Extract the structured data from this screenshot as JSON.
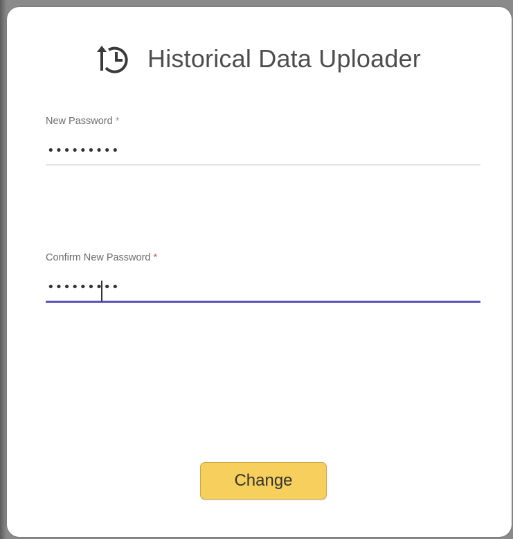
{
  "dialog": {
    "title": "Historical Data Uploader",
    "logo_icon": "upload-history-icon"
  },
  "fields": {
    "new_password": {
      "label": "New Password",
      "required_mark": "*",
      "value": "•••••••••"
    },
    "confirm_password": {
      "label": "Confirm New Password",
      "required_mark": "*",
      "value": "•••••••••"
    }
  },
  "actions": {
    "change_label": "Change"
  },
  "colors": {
    "accent": "#5a52b8",
    "button": "#f6cf5c",
    "required_active": "#e0533d"
  }
}
